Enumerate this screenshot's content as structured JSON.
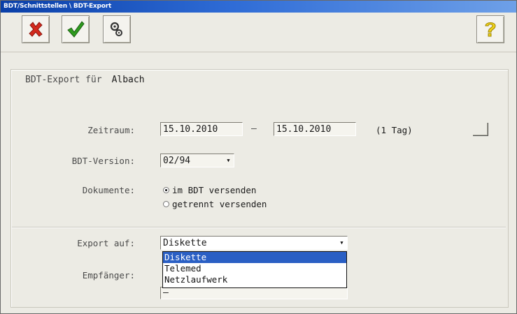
{
  "window": {
    "title": "BDT/Schnittstellen \\ BDT-Export"
  },
  "toolbar": {
    "cancel_icon": "close-icon",
    "ok_icon": "checkmark-icon",
    "settings_icon": "gears-icon",
    "help_icon": "question-icon"
  },
  "group": {
    "legend": "BDT-Export für",
    "patient": "Albach"
  },
  "zeitraum": {
    "label": "Zeitraum:",
    "from": "15.10.2010",
    "separator": "–",
    "to": "15.10.2010",
    "duration": "(1 Tag)"
  },
  "version": {
    "label": "BDT-Version:",
    "value": "02/94"
  },
  "dokumente": {
    "label": "Dokumente:",
    "options": [
      "im BDT versenden",
      "getrennt versenden"
    ],
    "selected_index": 0
  },
  "export": {
    "label": "Export auf:",
    "value": "Diskette",
    "options": [
      "Diskette",
      "Telemed",
      "Netzlaufwerk"
    ],
    "highlighted_index": 0
  },
  "empfaenger": {
    "label": "Empfänger:",
    "value": "–"
  },
  "colors": {
    "title_bar": "#0a3fa8",
    "selection": "#2a5fc4",
    "cancel": "#d42a1e",
    "ok": "#2e9b1e",
    "help": "#f0d21a"
  }
}
